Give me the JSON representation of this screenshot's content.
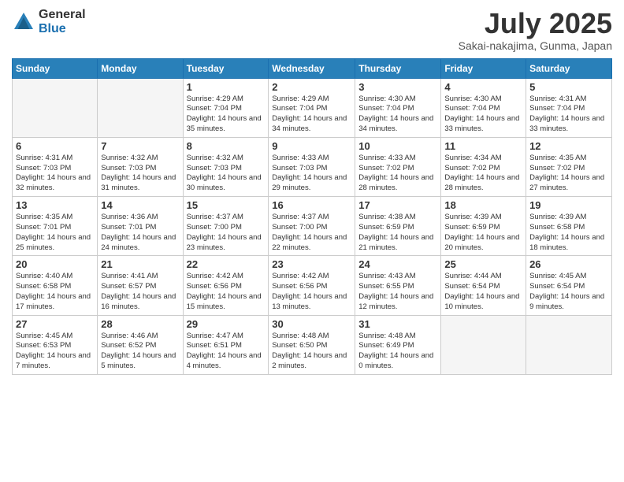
{
  "header": {
    "logo_general": "General",
    "logo_blue": "Blue",
    "title": "July 2025",
    "subtitle": "Sakai-nakajima, Gunma, Japan"
  },
  "weekdays": [
    "Sunday",
    "Monday",
    "Tuesday",
    "Wednesday",
    "Thursday",
    "Friday",
    "Saturday"
  ],
  "weeks": [
    [
      {
        "day": "",
        "info": ""
      },
      {
        "day": "",
        "info": ""
      },
      {
        "day": "1",
        "info": "Sunrise: 4:29 AM\nSunset: 7:04 PM\nDaylight: 14 hours and 35 minutes."
      },
      {
        "day": "2",
        "info": "Sunrise: 4:29 AM\nSunset: 7:04 PM\nDaylight: 14 hours and 34 minutes."
      },
      {
        "day": "3",
        "info": "Sunrise: 4:30 AM\nSunset: 7:04 PM\nDaylight: 14 hours and 34 minutes."
      },
      {
        "day": "4",
        "info": "Sunrise: 4:30 AM\nSunset: 7:04 PM\nDaylight: 14 hours and 33 minutes."
      },
      {
        "day": "5",
        "info": "Sunrise: 4:31 AM\nSunset: 7:04 PM\nDaylight: 14 hours and 33 minutes."
      }
    ],
    [
      {
        "day": "6",
        "info": "Sunrise: 4:31 AM\nSunset: 7:03 PM\nDaylight: 14 hours and 32 minutes."
      },
      {
        "day": "7",
        "info": "Sunrise: 4:32 AM\nSunset: 7:03 PM\nDaylight: 14 hours and 31 minutes."
      },
      {
        "day": "8",
        "info": "Sunrise: 4:32 AM\nSunset: 7:03 PM\nDaylight: 14 hours and 30 minutes."
      },
      {
        "day": "9",
        "info": "Sunrise: 4:33 AM\nSunset: 7:03 PM\nDaylight: 14 hours and 29 minutes."
      },
      {
        "day": "10",
        "info": "Sunrise: 4:33 AM\nSunset: 7:02 PM\nDaylight: 14 hours and 28 minutes."
      },
      {
        "day": "11",
        "info": "Sunrise: 4:34 AM\nSunset: 7:02 PM\nDaylight: 14 hours and 28 minutes."
      },
      {
        "day": "12",
        "info": "Sunrise: 4:35 AM\nSunset: 7:02 PM\nDaylight: 14 hours and 27 minutes."
      }
    ],
    [
      {
        "day": "13",
        "info": "Sunrise: 4:35 AM\nSunset: 7:01 PM\nDaylight: 14 hours and 25 minutes."
      },
      {
        "day": "14",
        "info": "Sunrise: 4:36 AM\nSunset: 7:01 PM\nDaylight: 14 hours and 24 minutes."
      },
      {
        "day": "15",
        "info": "Sunrise: 4:37 AM\nSunset: 7:00 PM\nDaylight: 14 hours and 23 minutes."
      },
      {
        "day": "16",
        "info": "Sunrise: 4:37 AM\nSunset: 7:00 PM\nDaylight: 14 hours and 22 minutes."
      },
      {
        "day": "17",
        "info": "Sunrise: 4:38 AM\nSunset: 6:59 PM\nDaylight: 14 hours and 21 minutes."
      },
      {
        "day": "18",
        "info": "Sunrise: 4:39 AM\nSunset: 6:59 PM\nDaylight: 14 hours and 20 minutes."
      },
      {
        "day": "19",
        "info": "Sunrise: 4:39 AM\nSunset: 6:58 PM\nDaylight: 14 hours and 18 minutes."
      }
    ],
    [
      {
        "day": "20",
        "info": "Sunrise: 4:40 AM\nSunset: 6:58 PM\nDaylight: 14 hours and 17 minutes."
      },
      {
        "day": "21",
        "info": "Sunrise: 4:41 AM\nSunset: 6:57 PM\nDaylight: 14 hours and 16 minutes."
      },
      {
        "day": "22",
        "info": "Sunrise: 4:42 AM\nSunset: 6:56 PM\nDaylight: 14 hours and 15 minutes."
      },
      {
        "day": "23",
        "info": "Sunrise: 4:42 AM\nSunset: 6:56 PM\nDaylight: 14 hours and 13 minutes."
      },
      {
        "day": "24",
        "info": "Sunrise: 4:43 AM\nSunset: 6:55 PM\nDaylight: 14 hours and 12 minutes."
      },
      {
        "day": "25",
        "info": "Sunrise: 4:44 AM\nSunset: 6:54 PM\nDaylight: 14 hours and 10 minutes."
      },
      {
        "day": "26",
        "info": "Sunrise: 4:45 AM\nSunset: 6:54 PM\nDaylight: 14 hours and 9 minutes."
      }
    ],
    [
      {
        "day": "27",
        "info": "Sunrise: 4:45 AM\nSunset: 6:53 PM\nDaylight: 14 hours and 7 minutes."
      },
      {
        "day": "28",
        "info": "Sunrise: 4:46 AM\nSunset: 6:52 PM\nDaylight: 14 hours and 5 minutes."
      },
      {
        "day": "29",
        "info": "Sunrise: 4:47 AM\nSunset: 6:51 PM\nDaylight: 14 hours and 4 minutes."
      },
      {
        "day": "30",
        "info": "Sunrise: 4:48 AM\nSunset: 6:50 PM\nDaylight: 14 hours and 2 minutes."
      },
      {
        "day": "31",
        "info": "Sunrise: 4:48 AM\nSunset: 6:49 PM\nDaylight: 14 hours and 0 minutes."
      },
      {
        "day": "",
        "info": ""
      },
      {
        "day": "",
        "info": ""
      }
    ]
  ]
}
